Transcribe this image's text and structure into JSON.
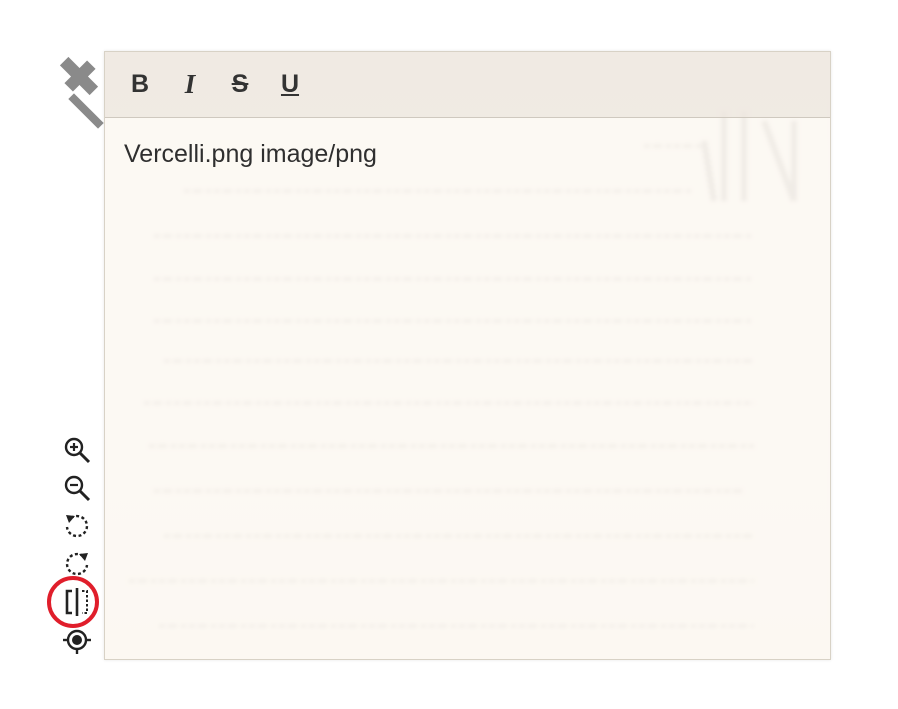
{
  "toolbar": {
    "bold_label": "B",
    "italic_label": "I",
    "strike_label": "S",
    "underline_label": "U"
  },
  "editor": {
    "content": "Vercelli.png image/png"
  },
  "tools": [
    {
      "name": "zoom-in-icon"
    },
    {
      "name": "zoom-out-icon"
    },
    {
      "name": "rotate-left-icon"
    },
    {
      "name": "rotate-right-icon"
    },
    {
      "name": "flip-horizontal-icon",
      "highlighted": true
    },
    {
      "name": "recenter-icon"
    }
  ],
  "colors": {
    "highlight": "#e01e2b",
    "icon": "#222222",
    "pin": "#8a8a8a"
  }
}
